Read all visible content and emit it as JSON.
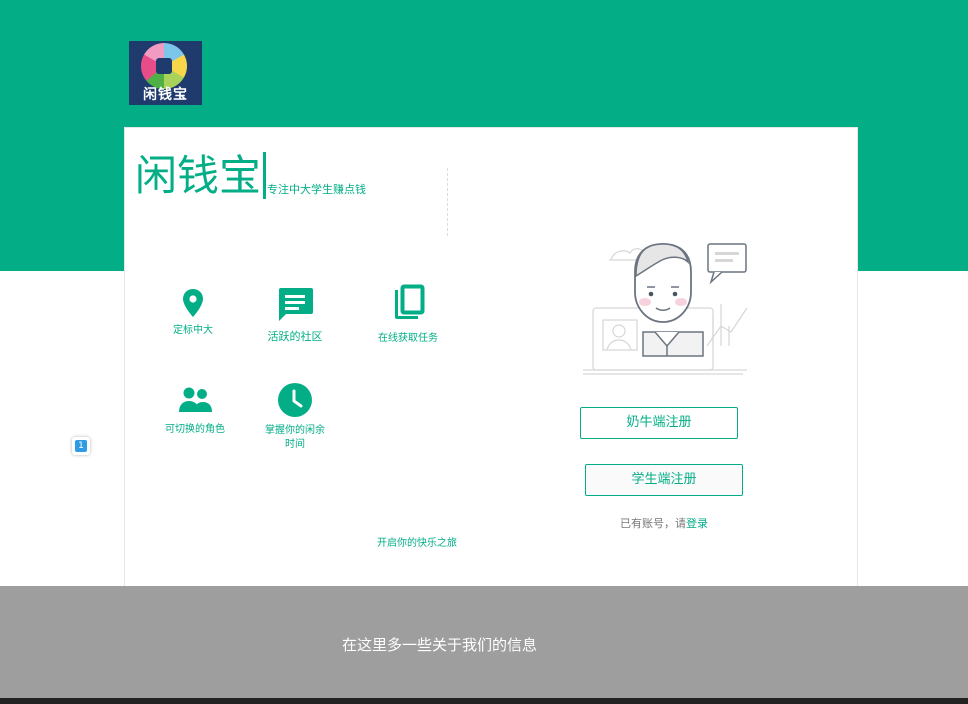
{
  "header": {
    "logo_text": "闲钱宝",
    "colors": {
      "brand": "#03ae87",
      "footer": "#9e9e9e"
    }
  },
  "hero": {
    "brand_title": "闲钱宝",
    "slogan": "专注中大学生赚点钱"
  },
  "features": [
    {
      "icon": "location-pin-icon",
      "label": "定标中大"
    },
    {
      "icon": "chat-icon",
      "label": "活跃的社区"
    },
    {
      "icon": "copy-icon",
      "label": "在线获取任务"
    },
    {
      "icon": "people-icon",
      "label": "可切换的角色"
    },
    {
      "icon": "clock-icon",
      "label_line1": "掌握你的闲余",
      "label_line2": "时间"
    }
  ],
  "auth": {
    "dairy_register": "奶牛端注册",
    "student_register": "学生端注册",
    "has_account": "已有账号，请",
    "login": "登录"
  },
  "journey": "开启你的快乐之旅",
  "side_badge": "1",
  "footer": {
    "text": "在这里多一些关于我们的信息"
  }
}
